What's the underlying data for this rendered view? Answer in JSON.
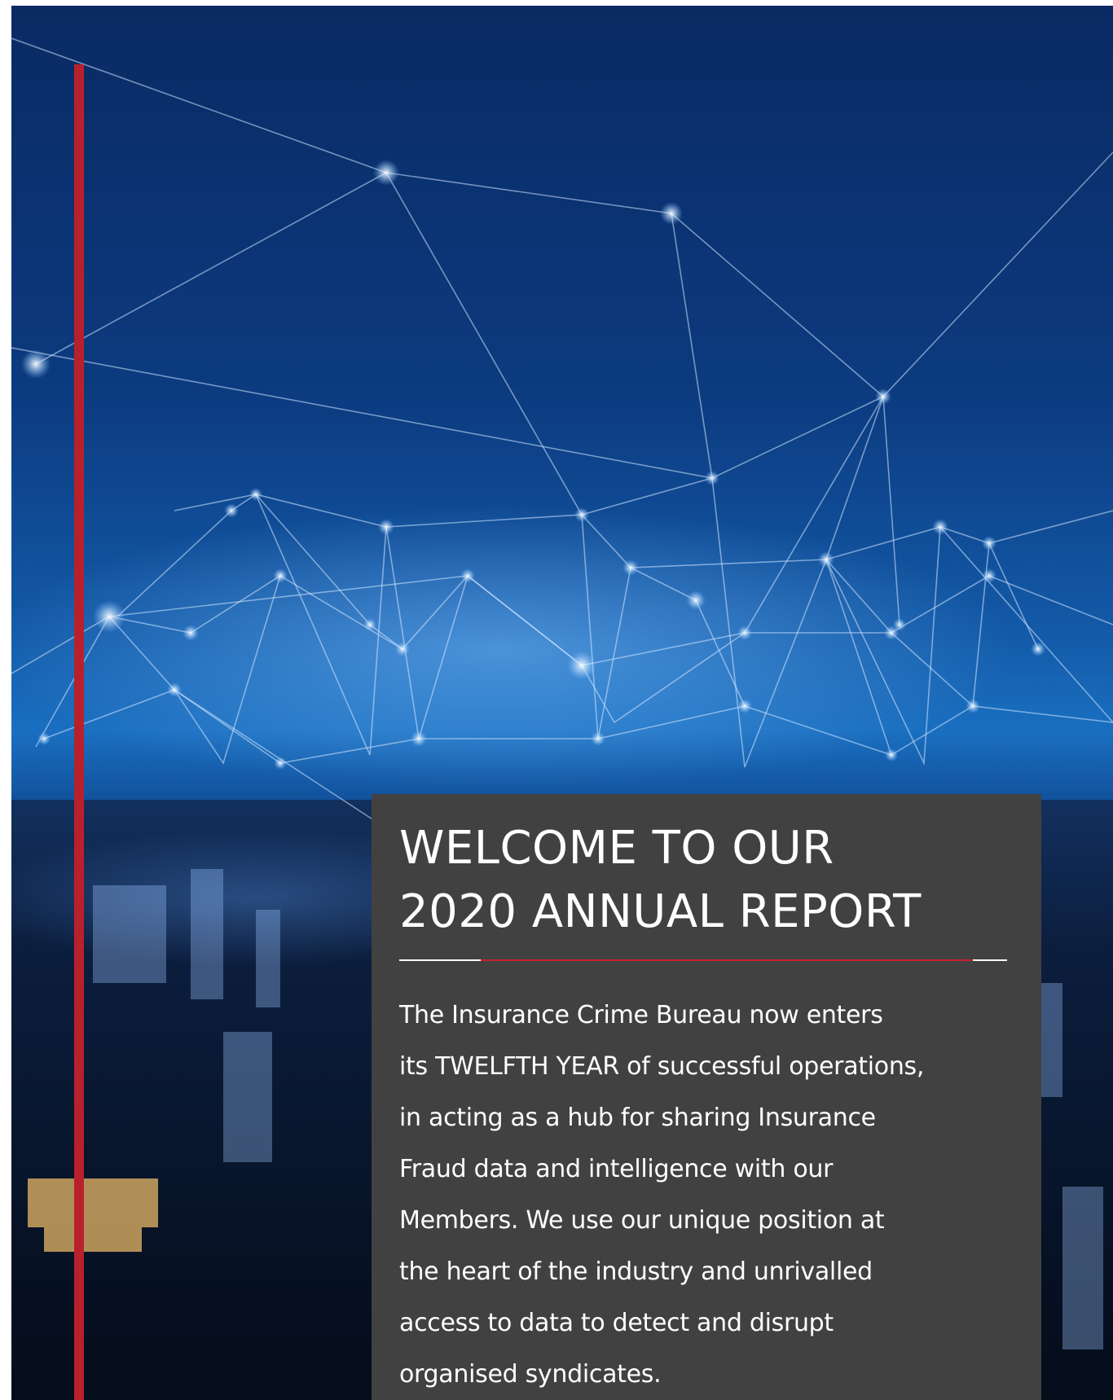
{
  "cover": {
    "title_lines": [
      "WELCOME TO OUR",
      "2020 ANNUAL REPORT"
    ],
    "intro_lines": [
      "The Insurance Crime Bureau now enters",
      "its TWELFTH YEAR of successful operations,",
      "in acting as a hub for sharing Insurance",
      "Fraud data and intelligence with our",
      "Members. We use our unique position at",
      "the heart of the industry and unrivalled",
      "access to data to detect and disrupt",
      "organised syndicates."
    ]
  },
  "colors": {
    "accent_red": "#b8212c",
    "panel_gray": "#424142",
    "text": "#ffffff",
    "sky_blue": "#135aa8"
  }
}
